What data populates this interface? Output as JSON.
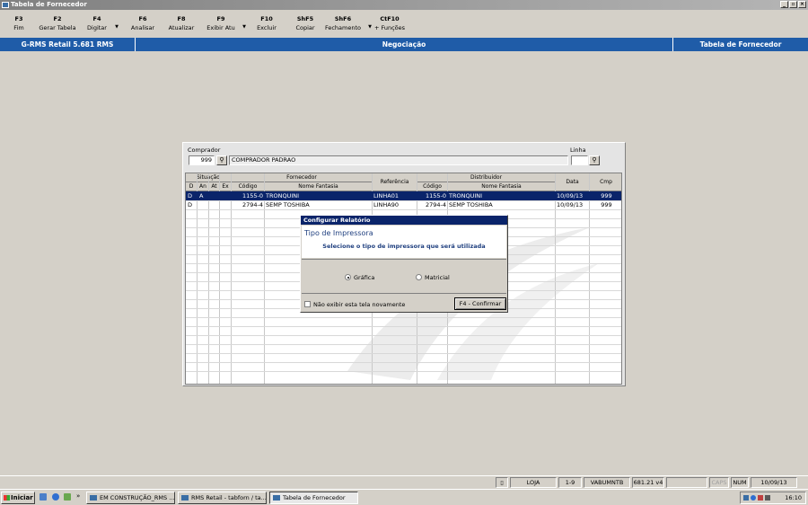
{
  "window": {
    "title": "Tabela de Fornecedor"
  },
  "toolbar": [
    {
      "key": "F3",
      "label": "Fim"
    },
    {
      "key": "F2",
      "label": "Gerar Tabela"
    },
    {
      "key": "F4",
      "label": "Digitar"
    },
    {
      "key": "F6",
      "label": "Analisar"
    },
    {
      "key": "F8",
      "label": "Atualizar"
    },
    {
      "key": "F9",
      "label": "Exibir Atu"
    },
    {
      "key": "F10",
      "label": "Excluir"
    },
    {
      "key": "ShF5",
      "label": "Copiar"
    },
    {
      "key": "ShF6",
      "label": "Fechamento"
    },
    {
      "key": "CtF10",
      "label": "+ Funções"
    }
  ],
  "header": {
    "system": "G-RMS Retail 5.681 RMS",
    "module": "Negociação",
    "screen": "Tabela de Fornecedor"
  },
  "filters": {
    "comprador_label": "Comprador",
    "comprador_code": "999",
    "comprador_name": "COMPRADOR PADRAO",
    "linha_label": "Linha",
    "linha_value": ""
  },
  "grid": {
    "group_headers": {
      "situacao": "Situação",
      "fornecedor": "Fornecedor",
      "referencia": "Referência",
      "distribuidor": "Distribuidor",
      "data": "Data",
      "cmp": "Cmp"
    },
    "sub_headers": {
      "d": "D",
      "an": "An",
      "at": "At",
      "ex": "Ex",
      "forn_codigo": "Código",
      "forn_nome": "Nome Fantasia",
      "dist_codigo": "Código",
      "dist_nome": "Nome Fantasia"
    },
    "rows": [
      {
        "d": "D",
        "an": "A",
        "at": "",
        "ex": "",
        "forn_codigo": "1155-0",
        "forn_nome": "TRONQUINI",
        "referencia": "LINHA01",
        "dist_codigo": "1155-0",
        "dist_nome": "TRONQUINI",
        "data": "10/09/13",
        "cmp": "999"
      },
      {
        "d": "D",
        "an": "",
        "at": "",
        "ex": "",
        "forn_codigo": "2794-4",
        "forn_nome": "SEMP TOSHIBA",
        "referencia": "LINHA90",
        "dist_codigo": "2794-4",
        "dist_nome": "SEMP TOSHIBA",
        "data": "10/09/13",
        "cmp": "999"
      }
    ]
  },
  "dialog": {
    "title": "Configurar Relatório",
    "heading": "Tipo de Impressora",
    "subtitle": "Selecione o tipo de impressora que será utilizada",
    "option_grafica": "Gráfica",
    "option_matricial": "Matricial",
    "selected": "Gráfica",
    "checkbox_label": "Não exibir esta tela novamente",
    "confirm_button": "F4 - Confirmar"
  },
  "statusbar": {
    "loja": "LOJA",
    "range": "1-9",
    "user": "VABUMNTB",
    "version": "681.21 v4",
    "caps": "CAPS",
    "num": "NUM",
    "date": "10/09/13"
  },
  "taskbar": {
    "start": "Iniciar",
    "tasks": [
      "EM CONSTRUÇÃO_RMS ...",
      "RMS Retail - tabforn / ta...",
      "Tabela de Fornecedor"
    ],
    "clock": "16:10"
  }
}
